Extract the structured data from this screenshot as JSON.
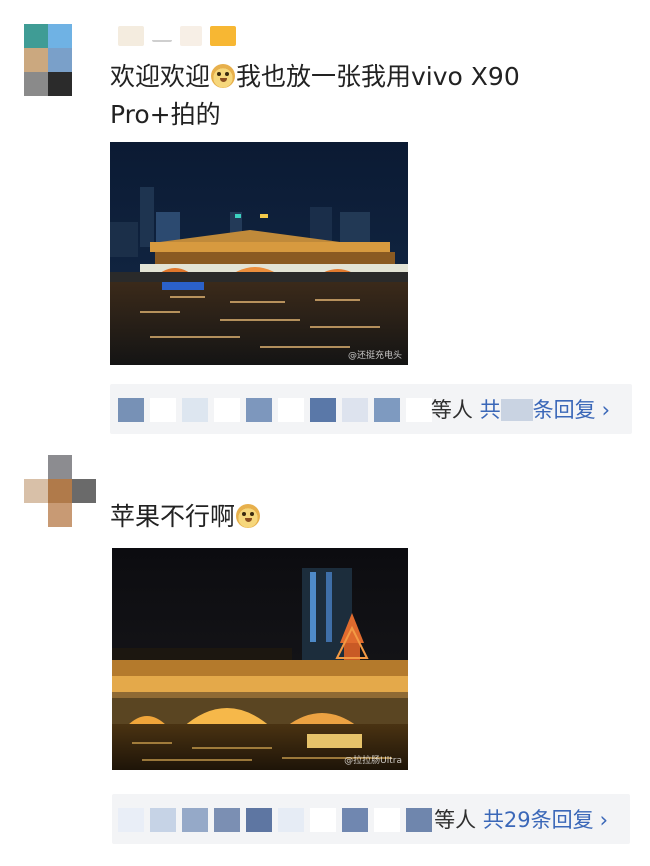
{
  "comments": [
    {
      "text_before_emoji": "欢迎欢迎",
      "emoji_icon": "dog-face",
      "text_after_emoji": "我也放一张我用vivo X90 Pro+拍的",
      "photo_watermark": "@还挺充电头",
      "reply_bar": {
        "others_label": "等人",
        "total_label": "共",
        "count_label": "",
        "tail_label": "条回复"
      }
    },
    {
      "text_before_emoji": "苹果不行啊",
      "emoji_icon": "dog-face",
      "text_after_emoji": "",
      "photo_watermark": "@拉拉肠Ultra",
      "reply_bar": {
        "others_label": "等人",
        "total_label": "共29条回复",
        "count_label": "",
        "tail_label": ""
      }
    }
  ],
  "colors": {
    "link_blue": "#3a67b8",
    "reply_bar_bg": "#f3f4f6",
    "text": "#222222"
  }
}
